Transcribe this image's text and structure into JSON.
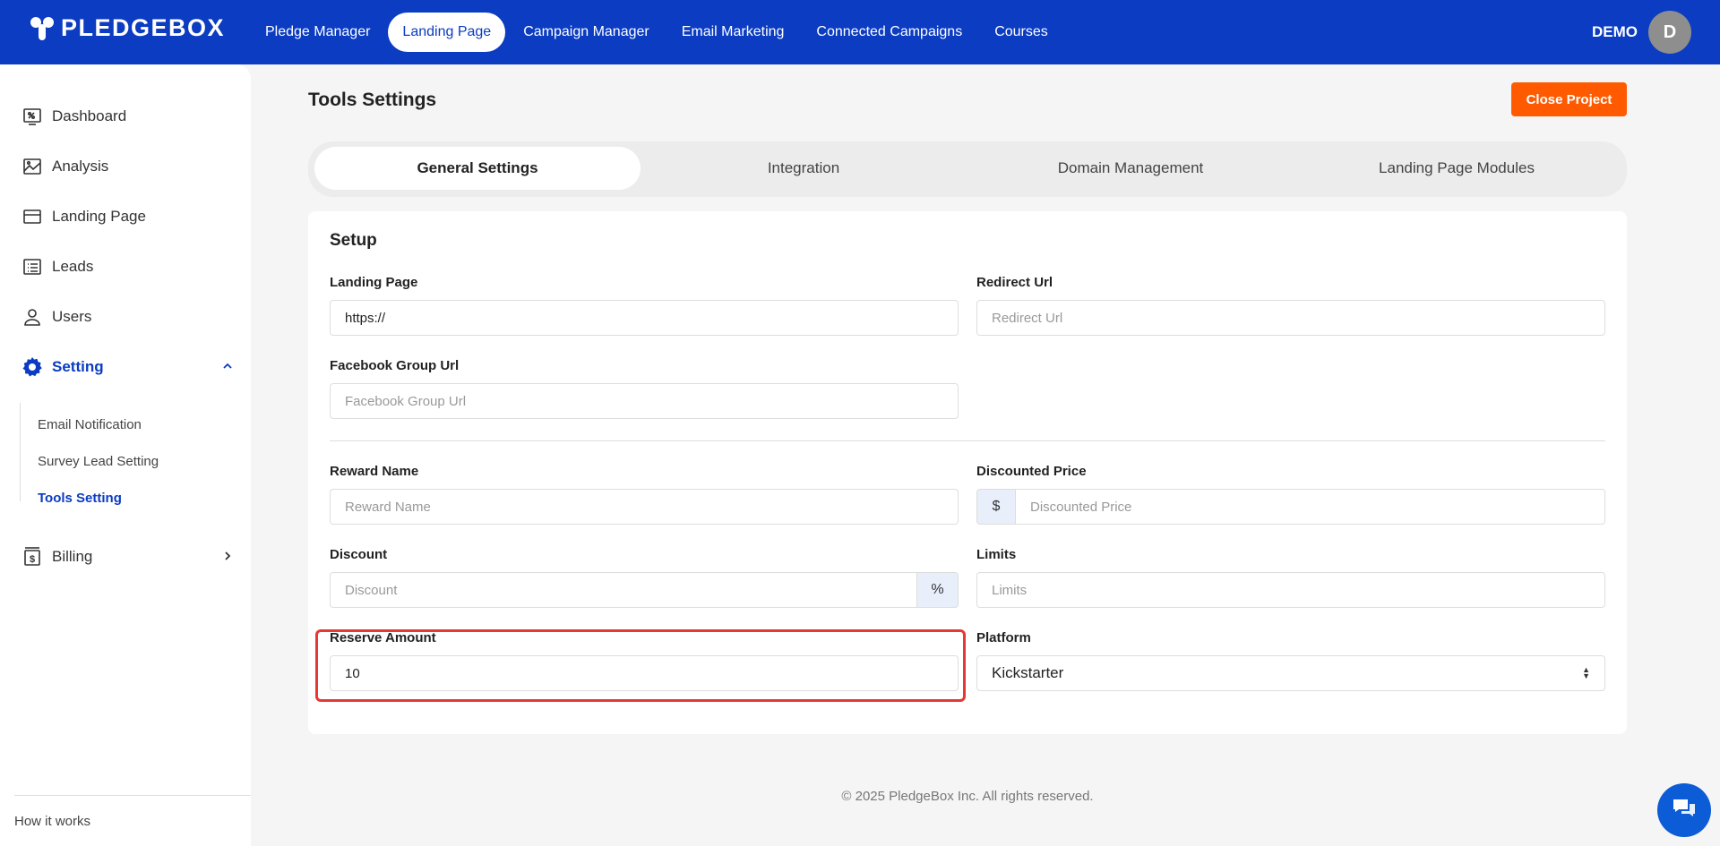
{
  "brand": {
    "name": "PLEDGEBOX"
  },
  "topnav": {
    "items": [
      "Pledge Manager",
      "Landing Page",
      "Campaign Manager",
      "Email Marketing",
      "Connected Campaigns",
      "Courses"
    ],
    "active": "Landing Page"
  },
  "user": {
    "name": "DEMO",
    "initial": "D"
  },
  "sidebar": {
    "items": [
      {
        "label": "Dashboard",
        "icon": "dashboard-icon"
      },
      {
        "label": "Analysis",
        "icon": "analysis-icon"
      },
      {
        "label": "Landing Page",
        "icon": "landing-page-icon"
      },
      {
        "label": "Leads",
        "icon": "leads-icon"
      },
      {
        "label": "Users",
        "icon": "user-icon"
      },
      {
        "label": "Setting",
        "icon": "gear-icon"
      },
      {
        "label": "Billing",
        "icon": "billing-icon"
      }
    ],
    "setting_children": [
      "Email Notification",
      "Survey Lead Setting",
      "Tools Setting"
    ],
    "active_child": "Tools Setting",
    "how_it_works": "How it works"
  },
  "page": {
    "title": "Tools Settings",
    "close_button": "Close Project"
  },
  "tabs": [
    "General Settings",
    "Integration",
    "Domain Management",
    "Landing Page Modules"
  ],
  "form": {
    "section_title": "Setup",
    "landing_page": {
      "label": "Landing Page",
      "value": "https://",
      "placeholder": ""
    },
    "redirect_url": {
      "label": "Redirect Url",
      "value": "",
      "placeholder": "Redirect Url"
    },
    "facebook_group_url": {
      "label": "Facebook Group Url",
      "value": "",
      "placeholder": "Facebook Group Url"
    },
    "reward_name": {
      "label": "Reward Name",
      "value": "",
      "placeholder": "Reward Name"
    },
    "discounted_price": {
      "label": "Discounted Price",
      "prefix": "$",
      "value": "",
      "placeholder": "Discounted Price"
    },
    "discount": {
      "label": "Discount",
      "suffix": "%",
      "value": "",
      "placeholder": "Discount"
    },
    "limits": {
      "label": "Limits",
      "value": "",
      "placeholder": "Limits"
    },
    "reserve_amount": {
      "label": "Reserve Amount",
      "value": "10",
      "placeholder": ""
    },
    "platform": {
      "label": "Platform",
      "value": "Kickstarter"
    }
  },
  "footer": {
    "text": "© 2025 PledgeBox Inc. All rights reserved."
  },
  "colors": {
    "brand_blue": "#0b3cc1",
    "accent_orange": "#ff5a00",
    "highlight_red": "#e53935"
  }
}
